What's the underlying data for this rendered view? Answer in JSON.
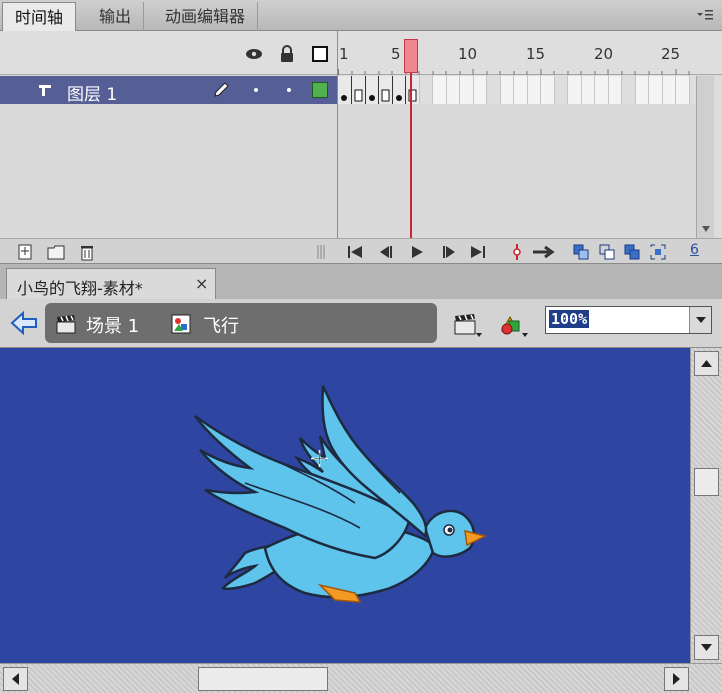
{
  "panel_tabs": [
    {
      "label": "时间轴",
      "active": true
    },
    {
      "label": "输出",
      "active": false
    },
    {
      "label": "动画编辑器",
      "active": false
    }
  ],
  "timeline": {
    "ruler_numbers": [
      "1",
      "5",
      "10",
      "15",
      "20",
      "25"
    ],
    "current_frame": 5,
    "layer": {
      "name": "图层 1"
    },
    "footer_frame_number": "6"
  },
  "document": {
    "tab_title": "小鸟的飞翔-素材*",
    "close_glyph": "×"
  },
  "edit_bar": {
    "crumbs": [
      {
        "label": "场景 1",
        "icon": "scene-clapper-icon"
      },
      {
        "label": "飞行",
        "icon": "graphic-symbol-icon"
      }
    ],
    "zoom": "100%"
  },
  "stage": {
    "background_color": "#2e46a1",
    "content": "bird"
  },
  "colors": {
    "layer_row": "#565e96",
    "playhead": "#cc2233",
    "bird_body": "#5ec4ec",
    "bird_beak": "#f39a25"
  }
}
